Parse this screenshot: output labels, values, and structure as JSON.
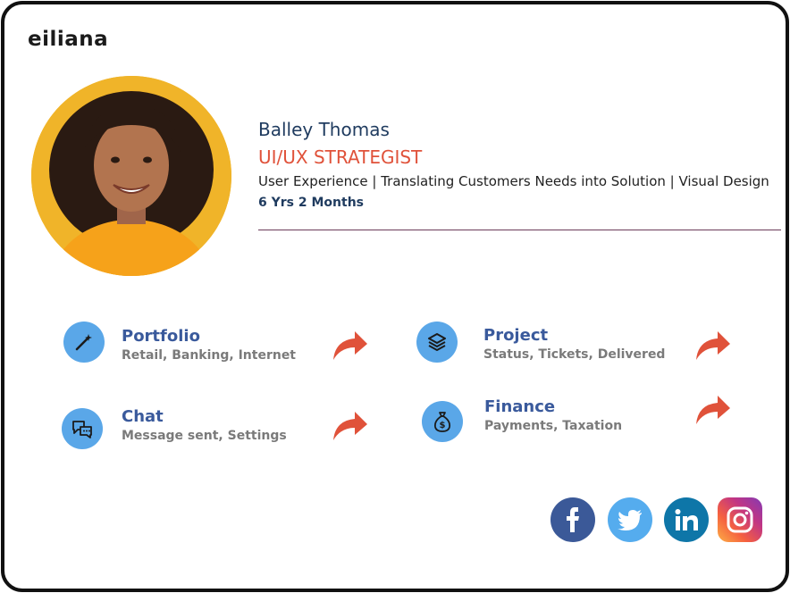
{
  "brand": {
    "logo_text": "eiliana"
  },
  "profile": {
    "name": "Balley Thomas",
    "role": "UI/UX STRATEGIST",
    "skills": "User Experience | Translating Customers Needs into Solution | Visual Design",
    "experience": "6 Yrs 2 Months"
  },
  "items": [
    {
      "title": "Portfolio",
      "subtitle": "Retail, Banking, Internet",
      "icon": "magic-wand-icon"
    },
    {
      "title": "Project",
      "subtitle": "Status, Tickets, Delivered",
      "icon": "layers-icon"
    },
    {
      "title": "Chat",
      "subtitle": "Message sent, Settings",
      "icon": "chat-bubbles-icon"
    },
    {
      "title": "Finance",
      "subtitle": "Payments, Taxation",
      "icon": "money-bag-icon"
    }
  ],
  "social": [
    {
      "name": "facebook-icon",
      "color": "#3b5998"
    },
    {
      "name": "twitter-icon",
      "color": "#55acee"
    },
    {
      "name": "linkedin-icon",
      "color": "#0e76a8"
    },
    {
      "name": "instagram-icon",
      "color": "#e1306c"
    }
  ],
  "colors": {
    "accent": "#e0523a",
    "primary": "#1f3b5f",
    "icon_bg": "#5aa7e8"
  }
}
